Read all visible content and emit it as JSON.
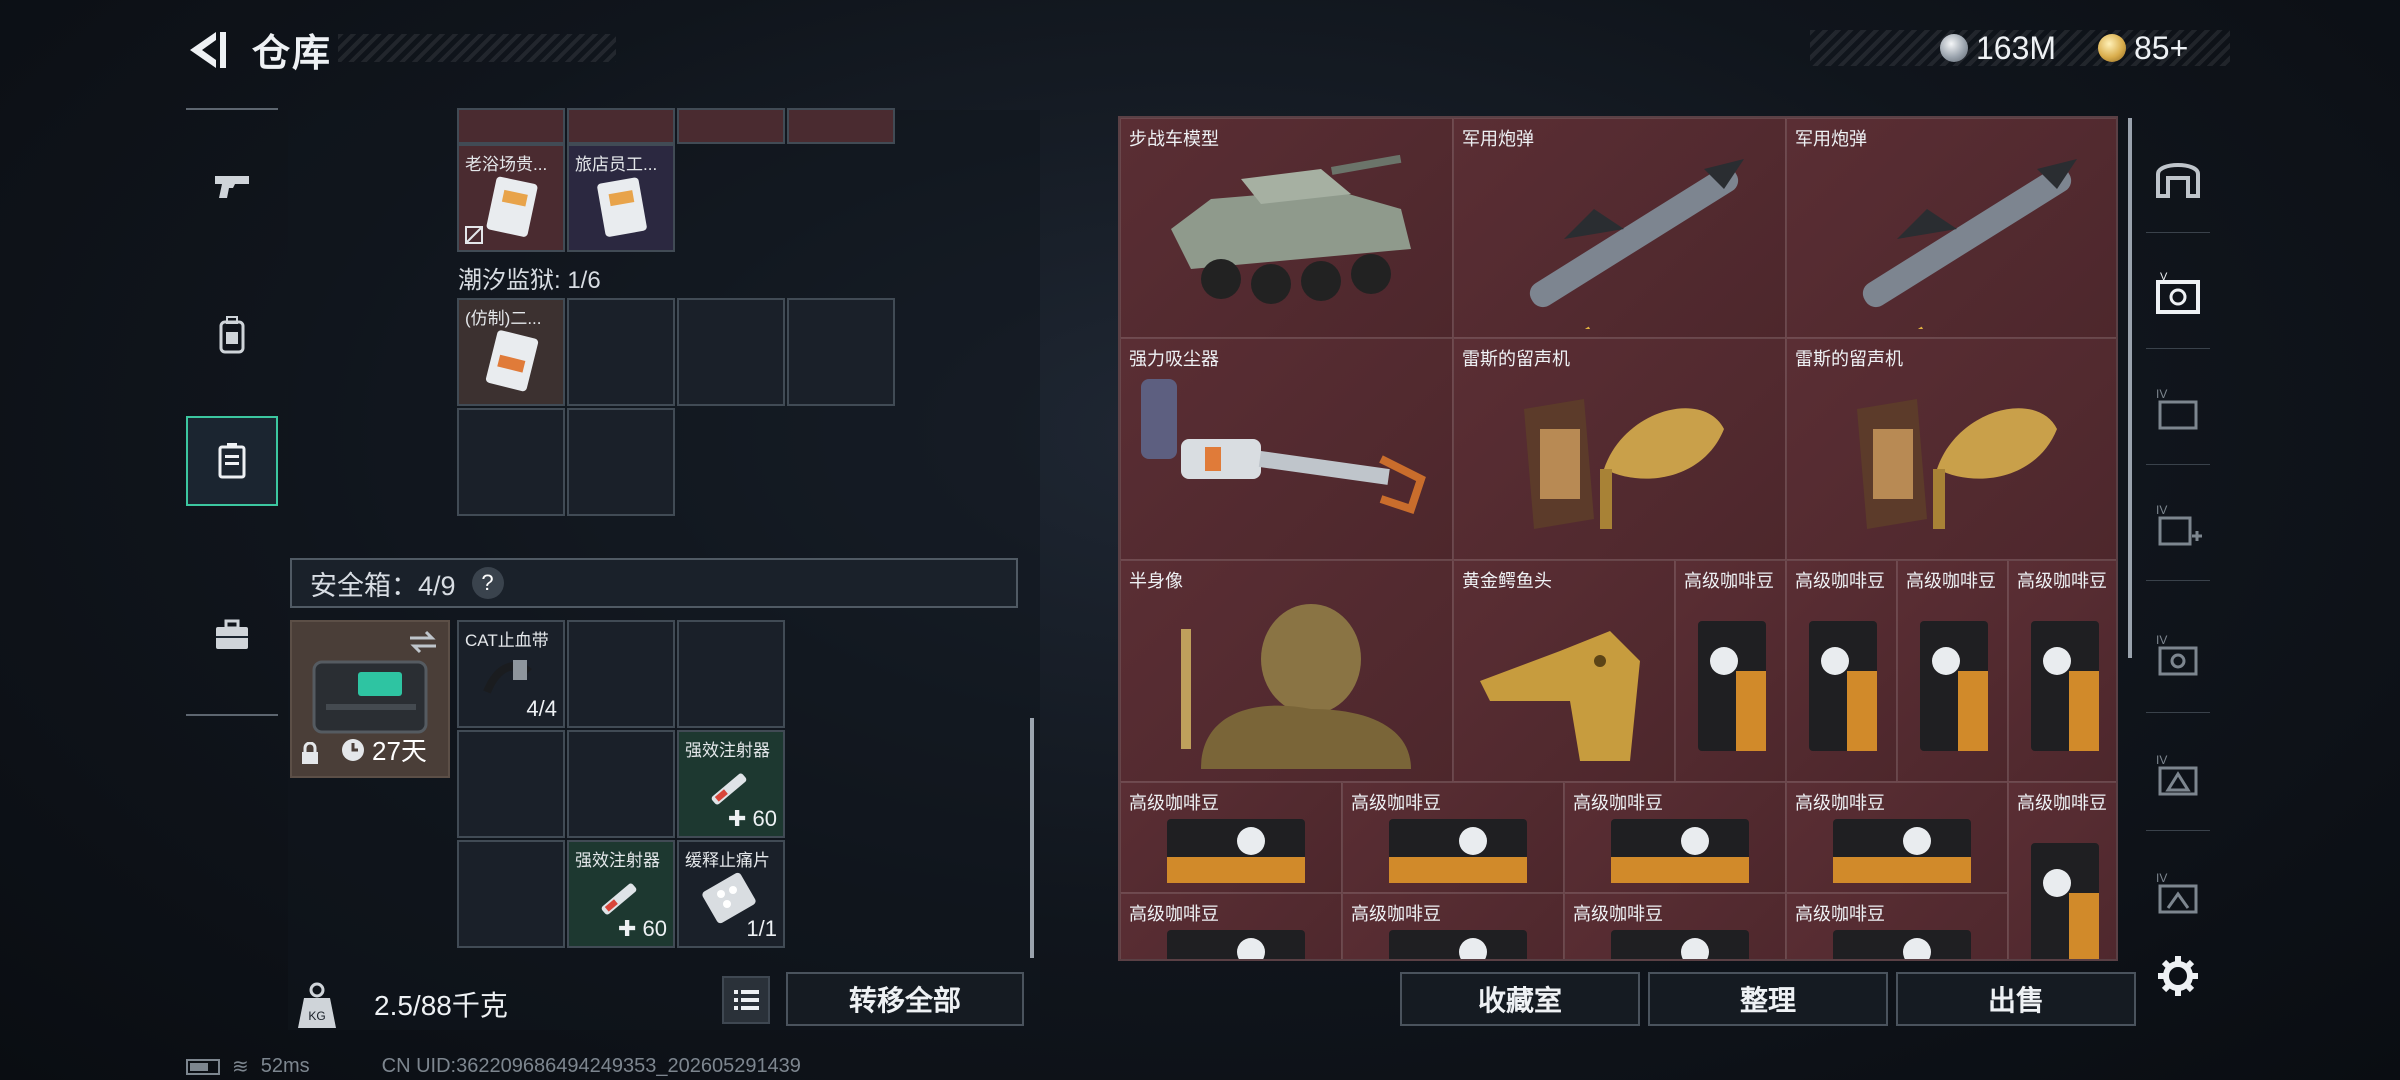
{
  "header": {
    "title": "仓库",
    "currency_silver": "163M",
    "currency_gold": "85+"
  },
  "left_nav": {
    "items": [
      "gun-icon",
      "backpack-icon",
      "safebox-icon",
      "briefcase-icon"
    ],
    "active_index": 2
  },
  "container": {
    "top_items": [
      {
        "label": "老浴场贵...",
        "color": "red",
        "locked": true
      },
      {
        "label": "旅店员工...",
        "color": "purple",
        "locked": false
      }
    ],
    "section_name": "潮汐监狱: 1/6",
    "section_items": [
      {
        "label": "(仿制)二...",
        "color": "brown"
      }
    ]
  },
  "safe_box": {
    "label": "安全箱：4/9",
    "help": "?",
    "timer": "27天",
    "items": [
      {
        "label": "CAT止血带",
        "count": "4/4"
      },
      {
        "label": "强效注射器",
        "count": "60"
      },
      {
        "label": "强效注射器",
        "count": "60"
      },
      {
        "label": "缓释止痛片",
        "count": "1/1"
      }
    ]
  },
  "bottom_bar": {
    "weight": "2.5/88千克",
    "transfer_all": "转移全部"
  },
  "stash": {
    "items": [
      {
        "label": "步战车模型",
        "icon": "ifv-model-icon"
      },
      {
        "label": "军用炮弹",
        "icon": "missile-icon"
      },
      {
        "label": "军用炮弹",
        "icon": "missile-icon"
      },
      {
        "label": "强力吸尘器",
        "icon": "vacuum-icon"
      },
      {
        "label": "雷斯的留声机",
        "icon": "gramophone-icon"
      },
      {
        "label": "雷斯的留声机",
        "icon": "gramophone-icon"
      },
      {
        "label": "半身像",
        "icon": "bust-icon"
      },
      {
        "label": "黄金鳄鱼头",
        "icon": "croc-head-icon"
      },
      {
        "label": "高级咖啡豆",
        "icon": "coffee-bag-icon"
      }
    ]
  },
  "actions": {
    "collection_room": "收藏室",
    "organize": "整理",
    "sell": "出售"
  },
  "footer": {
    "ping": "52ms",
    "uid": "CN UID:362209686494249353_202605291439"
  }
}
